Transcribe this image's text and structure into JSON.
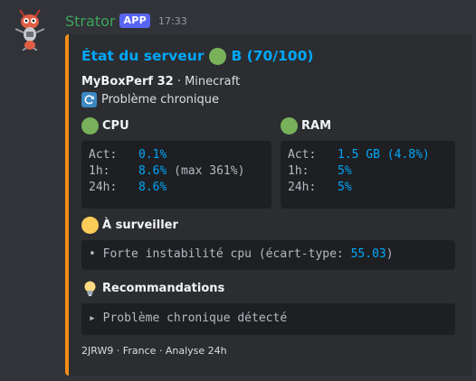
{
  "message": {
    "username": "Strator",
    "badge": "APP",
    "timestamp": "17:33"
  },
  "embed": {
    "accent_color": "#f48d19",
    "title_prefix": "État du serveur",
    "title_grade": "B (70/100)",
    "server_name": "MyBoxPerf 32",
    "server_game": " · Minecraft",
    "status_text": "Problème chronique",
    "cpu": {
      "name": "CPU",
      "rows": [
        {
          "label": "Act:",
          "value": "0.1%",
          "extra": ""
        },
        {
          "label": "1h:",
          "value": "8.6%",
          "extra": " (max 361%)"
        },
        {
          "label": "24h:",
          "value": "8.6%",
          "extra": ""
        }
      ]
    },
    "ram": {
      "name": "RAM",
      "rows": [
        {
          "label": "Act:",
          "value": "1.5 GB (4.8%)"
        },
        {
          "label": "1h:",
          "value": "5%"
        },
        {
          "label": "24h:",
          "value": "5%"
        }
      ]
    },
    "watch": {
      "name": "À surveiller",
      "text_prefix": "• Forte instabilité cpu (écart-type: ",
      "text_value": "55.03",
      "text_suffix": ")"
    },
    "recommendations": {
      "name": "Recommandations",
      "text": "▸ Problème chronique détecté"
    },
    "footer": "2JRW9 · France · Analyse 24h"
  },
  "icons": {
    "avatar": "robot-ant-avatar",
    "grade": "green-circle-icon",
    "status": "refresh-icon",
    "cpu": "green-circle-icon",
    "ram": "green-circle-icon",
    "watch": "yellow-circle-icon",
    "recommendations": "lightbulb-icon"
  }
}
